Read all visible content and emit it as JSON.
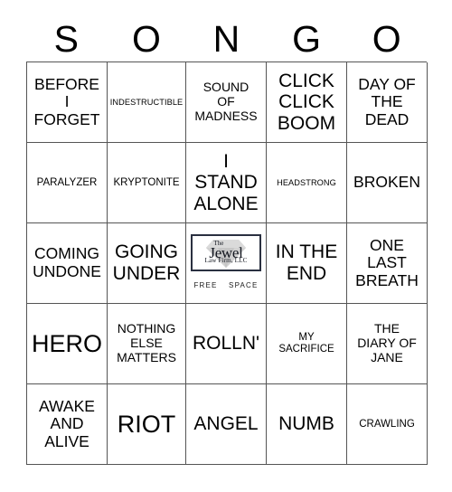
{
  "card": {
    "title": "SONGO Bingo Card",
    "header_letters": [
      "S",
      "O",
      "N",
      "G",
      "O"
    ],
    "grid": [
      [
        {
          "label": "BEFORE\nI\nFORGET",
          "size": "md"
        },
        {
          "label": "INDESTRUCTIBLE",
          "size": "xxs"
        },
        {
          "label": "SOUND\nOF\nMADNESS",
          "size": "sm"
        },
        {
          "label": "CLICK\nCLICK\nBOOM",
          "size": "lg"
        },
        {
          "label": "DAY OF\nTHE\nDEAD",
          "size": "md"
        }
      ],
      [
        {
          "label": "PARALYZER",
          "size": "xs"
        },
        {
          "label": "KRYPTONITE",
          "size": "xs"
        },
        {
          "label": "I\nSTAND\nALONE",
          "size": "lg"
        },
        {
          "label": "HEADSTRONG",
          "size": "xxs"
        },
        {
          "label": "BROKEN",
          "size": "md"
        }
      ],
      [
        {
          "label": "COMING\nUNDONE",
          "size": "md"
        },
        {
          "label": "GOING\nUNDER",
          "size": "lg"
        },
        {
          "label": "FREE SPACE",
          "size": "free"
        },
        {
          "label": "IN THE\nEND",
          "size": "lg"
        },
        {
          "label": "ONE\nLAST\nBREATH",
          "size": "md"
        }
      ],
      [
        {
          "label": "HERO",
          "size": "xl"
        },
        {
          "label": "NOTHING\nELSE\nMATTERS",
          "size": "sm"
        },
        {
          "label": "ROLLN'",
          "size": "lg"
        },
        {
          "label": "MY\nSACRIFICE",
          "size": "xs"
        },
        {
          "label": "THE\nDIARY OF\nJANE",
          "size": "sm"
        }
      ],
      [
        {
          "label": "AWAKE\nAND\nALIVE",
          "size": "md"
        },
        {
          "label": "RIOT",
          "size": "xl"
        },
        {
          "label": "ANGEL",
          "size": "lg"
        },
        {
          "label": "NUMB",
          "size": "lg"
        },
        {
          "label": "CRAWLING",
          "size": "xs"
        }
      ]
    ],
    "free_space": {
      "logo_the": "The",
      "logo_name": "Jewel",
      "logo_firm": "Law Firm, LLC",
      "free_label": "FREE",
      "space_label": "SPACE",
      "logo_border_color": "#2a3040",
      "diamond_color": "#b9b9b9"
    },
    "colors": {
      "background": "#ffffff",
      "grid_line": "#555555",
      "text": "#000000"
    }
  }
}
